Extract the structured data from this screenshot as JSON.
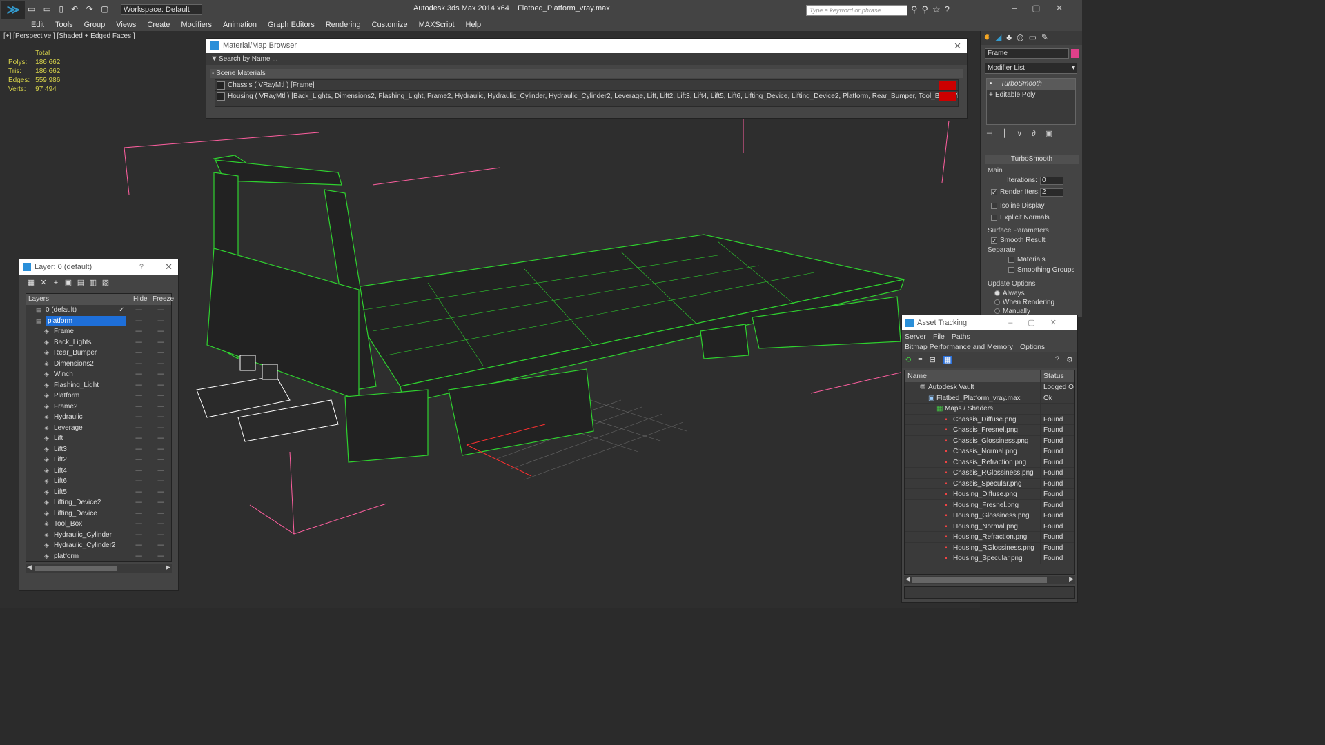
{
  "app": {
    "title": "Autodesk 3ds Max  2014 x64",
    "file": "Flatbed_Platform_vray.max",
    "workspace": "Workspace: Default",
    "search_placeholder": "Type a keyword or phrase"
  },
  "menu": [
    "Edit",
    "Tools",
    "Group",
    "Views",
    "Create",
    "Modifiers",
    "Animation",
    "Graph Editors",
    "Rendering",
    "Customize",
    "MAXScript",
    "Help"
  ],
  "viewport": {
    "label": "[+] [Perspective ] [Shaded + Edged Faces ]",
    "stats": {
      "header": "Total",
      "rows": [
        {
          "k": "Polys:",
          "v": "186 662"
        },
        {
          "k": "Tris:",
          "v": "186 662"
        },
        {
          "k": "Edges:",
          "v": "559 986"
        },
        {
          "k": "Verts:",
          "v": "97 494"
        }
      ]
    }
  },
  "material_browser": {
    "title": "Material/Map Browser",
    "search_placeholder": "Search by Name ...",
    "section": "- Scene Materials",
    "items": [
      "Chassis  ( VRayMtl ) [Frame]",
      "Housing  ( VRayMtl ) [Back_Lights, Dimensions2, Flashing_Light, Frame2, Hydraulic, Hydraulic_Cylinder, Hydraulic_Cylinder2, Leverage, Lift, Lift2, Lift3, Lift4, Lift5, Lift6, Lifting_Device, Lifting_Device2, Platform, Rear_Bumper, Tool_Box, Winch]"
    ]
  },
  "layer_panel": {
    "title": "Layer: 0 (default)",
    "help": "?",
    "columns": {
      "layers": "Layers",
      "hide": "Hide",
      "freeze": "Freeze"
    },
    "layers": [
      {
        "name": "0 (default)",
        "indent": 1
      },
      {
        "name": "platform",
        "indent": 1,
        "selected": true
      },
      {
        "name": "Frame",
        "indent": 2
      },
      {
        "name": "Back_Lights",
        "indent": 2
      },
      {
        "name": "Rear_Bumper",
        "indent": 2
      },
      {
        "name": "Dimensions2",
        "indent": 2
      },
      {
        "name": "Winch",
        "indent": 2
      },
      {
        "name": "Flashing_Light",
        "indent": 2
      },
      {
        "name": "Platform",
        "indent": 2
      },
      {
        "name": "Frame2",
        "indent": 2
      },
      {
        "name": "Hydraulic",
        "indent": 2
      },
      {
        "name": "Leverage",
        "indent": 2
      },
      {
        "name": "Lift",
        "indent": 2
      },
      {
        "name": "Lift3",
        "indent": 2
      },
      {
        "name": "Lift2",
        "indent": 2
      },
      {
        "name": "Lift4",
        "indent": 2
      },
      {
        "name": "Lift6",
        "indent": 2
      },
      {
        "name": "Lift5",
        "indent": 2
      },
      {
        "name": "Lifting_Device2",
        "indent": 2
      },
      {
        "name": "Lifting_Device",
        "indent": 2
      },
      {
        "name": "Tool_Box",
        "indent": 2
      },
      {
        "name": "Hydraulic_Cylinder",
        "indent": 2
      },
      {
        "name": "Hydraulic_Cylinder2",
        "indent": 2
      },
      {
        "name": "platform",
        "indent": 2
      }
    ]
  },
  "command_panel": {
    "object_name": "Frame",
    "modifier_list": "Modifier List",
    "stack": [
      "TurboSmooth",
      "Editable Poly"
    ],
    "rollout_title": "TurboSmooth",
    "main_group": "Main",
    "iterations_label": "Iterations:",
    "iterations_value": "0",
    "render_iters_label": "Render Iters:",
    "render_iters_value": "2",
    "isoline": "Isoline Display",
    "explicit_normals": "Explicit Normals",
    "surface_params": "Surface Parameters",
    "smooth_result": "Smooth Result",
    "separate": "Separate",
    "materials": "Materials",
    "smoothing_groups": "Smoothing Groups",
    "update_options": "Update Options",
    "always": "Always",
    "when_rendering": "When Rendering",
    "manually": "Manually"
  },
  "asset_tracking": {
    "title": "Asset Tracking",
    "menu": [
      "Server",
      "File",
      "Paths"
    ],
    "menu2": [
      "Bitmap Performance and Memory",
      "Options"
    ],
    "columns": {
      "name": "Name",
      "status": "Status"
    },
    "rows": [
      {
        "name": "Autodesk Vault",
        "status": "Logged Ou",
        "indent": 1
      },
      {
        "name": "Flatbed_Platform_vray.max",
        "status": "Ok",
        "indent": 2
      },
      {
        "name": "Maps / Shaders",
        "status": "",
        "indent": 3
      },
      {
        "name": "Chassis_Diffuse.png",
        "status": "Found",
        "indent": 4
      },
      {
        "name": "Chassis_Fresnel.png",
        "status": "Found",
        "indent": 4
      },
      {
        "name": "Chassis_Glossiness.png",
        "status": "Found",
        "indent": 4
      },
      {
        "name": "Chassis_Normal.png",
        "status": "Found",
        "indent": 4
      },
      {
        "name": "Chassis_Refraction.png",
        "status": "Found",
        "indent": 4
      },
      {
        "name": "Chassis_RGlossiness.png",
        "status": "Found",
        "indent": 4
      },
      {
        "name": "Chassis_Specular.png",
        "status": "Found",
        "indent": 4
      },
      {
        "name": "Housing_Diffuse.png",
        "status": "Found",
        "indent": 4
      },
      {
        "name": "Housing_Fresnel.png",
        "status": "Found",
        "indent": 4
      },
      {
        "name": "Housing_Glossiness.png",
        "status": "Found",
        "indent": 4
      },
      {
        "name": "Housing_Normal.png",
        "status": "Found",
        "indent": 4
      },
      {
        "name": "Housing_Refraction.png",
        "status": "Found",
        "indent": 4
      },
      {
        "name": "Housing_RGlossiness.png",
        "status": "Found",
        "indent": 4
      },
      {
        "name": "Housing_Specular.png",
        "status": "Found",
        "indent": 4
      }
    ]
  },
  "colors": {
    "wire": "#2fd12f",
    "accent": "#1e6fd9",
    "bounds": "#ff5fa0"
  }
}
